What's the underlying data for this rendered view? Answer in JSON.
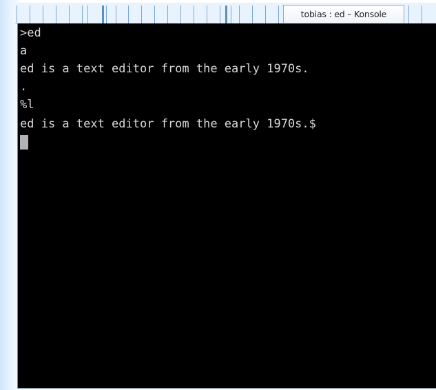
{
  "window": {
    "title": "tobias : ed – Konsole"
  },
  "terminal": {
    "lines": [
      ">ed",
      "a",
      "ed is a text editor from the early 1970s.",
      ".",
      "%l",
      "ed is a text editor from the early 1970s.$"
    ]
  },
  "colors": {
    "terminal_background": "#000000",
    "terminal_text": "#d8d8d8",
    "cursor": "#b2b2b2",
    "taskbar_accent": "#7aa6cf"
  }
}
